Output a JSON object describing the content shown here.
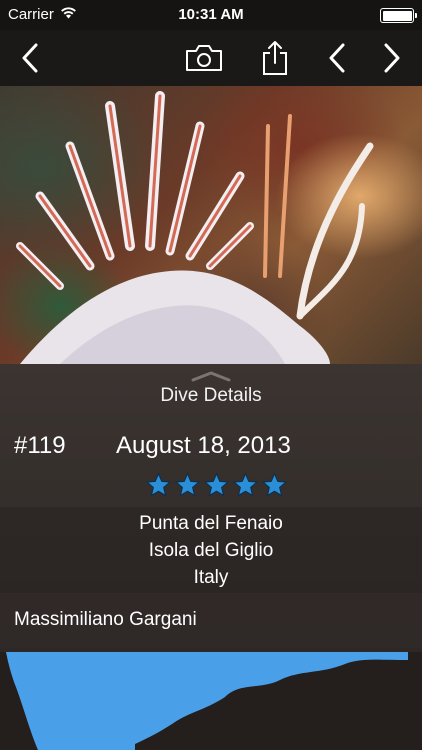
{
  "status_bar": {
    "carrier": "Carrier",
    "time": "10:31 AM",
    "wifi_icon": "wifi-icon",
    "battery_level": 1.0
  },
  "nav": {
    "back_icon": "chevron-left-icon",
    "camera_icon": "camera-icon",
    "share_icon": "share-icon",
    "previous_icon": "chevron-left-icon",
    "next_icon": "chevron-right-icon"
  },
  "details": {
    "title": "Dive Details",
    "dive_number": "#119",
    "date": "August 18, 2013",
    "rating": 5,
    "rating_max": 5,
    "star_color": "#2a8fd6",
    "location": {
      "site": "Punta del Fenaio",
      "region": "Isola del Giglio",
      "country": "Italy"
    },
    "buddy": "Massimiliano Gargani"
  },
  "profile": {
    "fill_color": "#4aa0e8"
  }
}
